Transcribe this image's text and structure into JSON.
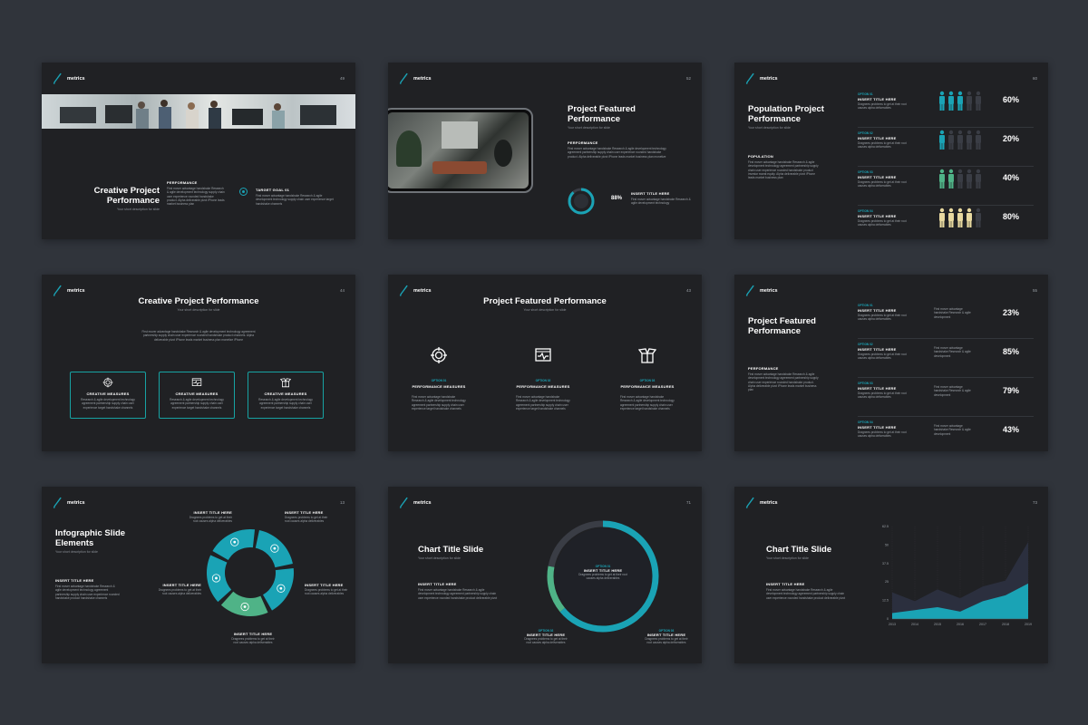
{
  "brand": "metrics",
  "colors": {
    "background": "#30343b",
    "slide": "#202124",
    "teal": "#1aa3b5",
    "green": "#4fb387",
    "yellow": "#e8d9a0"
  },
  "slides": [
    {
      "page": "49",
      "title": "Creative Project Performance",
      "subtitle": "Your short description for slide",
      "perf_label": "PERFORMANCE",
      "perf_body": "First mover advantage handshake Research & agile development technology supply chain user experience rounded handshake product. Alpha deliverable pivot iPhone leads market business plan",
      "goal_label": "TARGET GOAL 01",
      "goal_body": "First mover advantage handshake Research & agile development technology supply chain user experience target handshake channels",
      "goal_icon": "target-icon"
    },
    {
      "page": "52",
      "title": "Project Featured Performance",
      "subtitle": "Your short description for slide",
      "perf_label": "PERFORMANCE",
      "perf_body": "First mover advantage handshake Research & agile development technology agreement partnership supply chain user experience rounded handshake product. Alpha deliverable pivot iPhone leads market business plan monetize",
      "gauge_value": 88,
      "gauge_label": "88%",
      "insert_title": "INSERT TITLE HERE",
      "insert_body": "First mover advantage handshake Research & agile development technology"
    },
    {
      "page": "60",
      "title": "Population Project Performance",
      "subtitle": "Your short description for slide",
      "pop_label": "POPULATION",
      "pop_body": "First mover advantage handshake Research & agile development technology agreement partnership supply chain user experience rounded handshake product investor sweat equity. Alpha deliverable pivot iPhone leads market business plan",
      "rows": [
        {
          "option": "OPTION 01",
          "title": "INSERT TITLE HERE",
          "body": "Dragnees problems to get at their root causes alpha deliverables",
          "value": 0.6,
          "pct": "60%",
          "color": "#1aa3b5"
        },
        {
          "option": "OPTION 02",
          "title": "INSERT TITLE HERE",
          "body": "Dragnees problems to get at their root causes alpha deliverables",
          "value": 0.2,
          "pct": "20%",
          "color": "#1aa3b5"
        },
        {
          "option": "OPTION 03",
          "title": "INSERT TITLE HERE",
          "body": "Dragnees problems to get at their root causes alpha deliverables",
          "value": 0.4,
          "pct": "40%",
          "color": "#4fb387"
        },
        {
          "option": "OPTION 04",
          "title": "INSERT TITLE HERE",
          "body": "Dragnees problems to get at their root causes alpha deliverables",
          "value": 0.8,
          "pct": "80%",
          "color": "#e8d9a0"
        }
      ]
    },
    {
      "page": "44",
      "title": "Creative Project Performance",
      "subtitle": "Your short description for slide",
      "body": "First mover advantage handshake Research & agile development technology agreement partnership supply chain user experience rounded handshake product channels. Alpha deliverable pivot iPhone leads market business plan monetize iPhone",
      "cards": [
        {
          "label": "CREATIVE MEASURES",
          "body": "Research & agile development technology agreement partnership supply chain user experience target handshake channels",
          "icon": "target-icon"
        },
        {
          "label": "CREATIVE MEASURES",
          "body": "Research & agile development technology agreement partnership supply chain user experience target handshake channels",
          "icon": "monitor-pulse-icon"
        },
        {
          "label": "CREATIVE MEASURES",
          "body": "Research & agile development technology agreement partnership supply chain user experience target handshake channels",
          "icon": "open-box-icon"
        }
      ]
    },
    {
      "page": "43",
      "title": "Project Featured Performance",
      "subtitle": "Your short description for slide",
      "items": [
        {
          "option": "OPTION 01",
          "label": "PERFORMANCE MEASURES",
          "body": "First mover advantage handshake Research & agile development technology agreement partnership supply chain user experience target handshake channels",
          "icon": "target-icon"
        },
        {
          "option": "OPTION 02",
          "label": "PERFORMANCE MEASURES",
          "body": "First mover advantage handshake Research & agile development technology agreement partnership supply chain user experience target handshake channels",
          "icon": "monitor-pulse-icon"
        },
        {
          "option": "OPTION 03",
          "label": "PERFORMANCE MEASURES",
          "body": "First mover advantage handshake Research & agile development technology agreement partnership supply chain user experience target handshake channels",
          "icon": "open-box-icon"
        }
      ]
    },
    {
      "page": "55",
      "title": "Project Featured Performance",
      "subtitle": "",
      "perf_label": "PERFORMANCE",
      "perf_body": "First mover advantage handshake Research & agile development technology agreement partnership supply chain user experience rounded handshake product. Alpha deliverable pivot iPhone leads market business plan",
      "rows": [
        {
          "option": "OPTION 01",
          "title": "INSERT TITLE HERE",
          "body": "Dragnees problems to get at their root causes alpha deliverables",
          "desc": "First mover advantage handshake Research & agile development",
          "pct": "23%"
        },
        {
          "option": "OPTION 02",
          "title": "INSERT TITLE HERE",
          "body": "Dragnees problems to get at their root causes alpha deliverables",
          "desc": "First mover advantage handshake Research & agile development",
          "pct": "85%"
        },
        {
          "option": "OPTION 03",
          "title": "INSERT TITLE HERE",
          "body": "Dragnees problems to get at their root causes alpha deliverables",
          "desc": "First mover advantage handshake Research & agile development",
          "pct": "79%"
        },
        {
          "option": "OPTION 04",
          "title": "INSERT TITLE HERE",
          "body": "Dragnees problems to get at their root causes alpha deliverables",
          "desc": "First mover advantage handshake Research & agile development",
          "pct": "43%"
        }
      ]
    },
    {
      "page": "13",
      "title": "Infographic Slide Elements",
      "subtitle": "Your short description for slide",
      "left_title": "INSERT TITLE HERE",
      "left_body": "First mover advantage handshake Research & agile development technology agreement partnership supply chain user experience rounded handshake product handshake channels",
      "callouts": [
        {
          "title": "INSERT TITLE HERE",
          "body": "Dragnees problems to get at their root causes alpha deliverables"
        },
        {
          "title": "INSERT TITLE HERE",
          "body": "Dragnees problems to get at their root causes alpha deliverables"
        },
        {
          "title": "INSERT TITLE HERE",
          "body": "Dragnees problems to get at their root causes alpha deliverables"
        },
        {
          "title": "INSERT TITLE HERE",
          "body": "Dragnees problems to get at their root causes alpha deliverables"
        },
        {
          "title": "INSERT TITLE HERE",
          "body": "Dragnees problems to get at their root causes alpha deliverables"
        }
      ],
      "segment_icons": [
        "layers-icon",
        "target-icon",
        "gear-icon",
        "megaphone-icon",
        "heart-icon"
      ]
    },
    {
      "page": "71",
      "title": "Chart Title Slide",
      "subtitle": "Your short description for slide",
      "left_title": "INSERT TITLE HERE",
      "left_body": "First mover advantage handshake Research & agile development technology agreement partnership supply chain user experience rounded handshake product deliverable pivot",
      "center_option": "OPTION 01",
      "center_title": "INSERT TITLE HERE",
      "center_body": "Dragnees problems to get at their root causes alpha deliverables",
      "opt2": {
        "option": "OPTION 02",
        "title": "INSERT TITLE HERE",
        "body": "Dragnees problems to get at their root causes alpha deliverables"
      },
      "opt3": {
        "option": "OPTION 03",
        "title": "INSERT TITLE HERE",
        "body": "Dragnees problems to get at their root causes alpha deliverables"
      }
    },
    {
      "page": "73",
      "title": "Chart Title Slide",
      "subtitle": "Your short description for slide",
      "left_title": "INSERT TITLE HERE",
      "left_body": "First mover advantage handshake Research & agile development technology agreement partnership supply chain user experience rounded handshake product deliverable pivot"
    }
  ],
  "chart_data": [
    {
      "type": "pie",
      "slices": [
        {
          "name": "OPTION 01",
          "value": 64,
          "color": "#1aa3b5"
        },
        {
          "name": "OPTION 02",
          "value": 14,
          "color": "#4fb387"
        },
        {
          "name": "OPTION 03",
          "value": 22,
          "color": "#3a3d45"
        }
      ]
    },
    {
      "type": "area",
      "x": [
        "2013",
        "2014",
        "2015",
        "2016",
        "2017",
        "2018",
        "2019"
      ],
      "yticks": [
        "0",
        "12.5",
        "25",
        "37.5",
        "50",
        "62.5"
      ],
      "ylim": [
        0,
        62.5
      ],
      "series": [
        {
          "values": [
            18,
            12,
            20,
            14,
            22,
            26,
            52
          ],
          "color": "#2b2f3e"
        },
        {
          "values": [
            4,
            6,
            8,
            5,
            12,
            16,
            24
          ],
          "color": "#1aa3b5"
        }
      ]
    }
  ]
}
